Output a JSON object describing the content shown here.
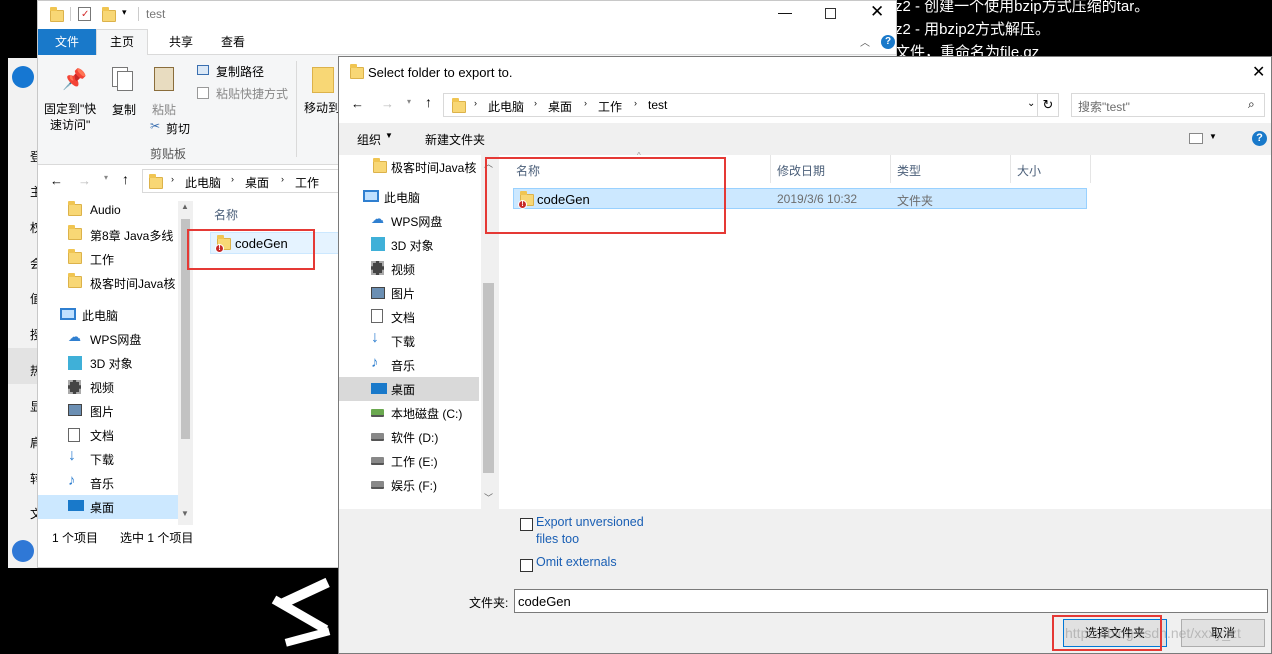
{
  "background": {
    "line1": "z2 - 创建一个使用bzip方式压缩的tar。",
    "line2": "z2 - 用bzip2方式解压。",
    "line3": "文件，重命名为file.gz",
    "left_chars": [
      "登",
      "主",
      "权",
      "会",
      "值",
      "授",
      "热",
      "显",
      "肩",
      "转",
      "文"
    ]
  },
  "explorer": {
    "title": "test",
    "tabs": [
      "文件",
      "主页",
      "共享",
      "查看"
    ],
    "ribbon": {
      "pin": "固定到\"快\n速访问\"",
      "copy": "复制",
      "paste": "粘贴",
      "copy_path": "复制路径",
      "paste_shortcut": "粘贴快捷方式",
      "cut": "剪切",
      "clipboard": "剪贴板",
      "move_to": "移动到"
    },
    "breadcrumb": [
      "此电脑",
      "桌面",
      "工作"
    ],
    "nav_items": [
      "Audio",
      "第8章 Java多线",
      "工作",
      "极客时间Java核",
      "此电脑",
      "WPS网盘",
      "3D 对象",
      "视频",
      "图片",
      "文档",
      "下载",
      "音乐",
      "桌面"
    ],
    "column_name": "名称",
    "file_name": "codeGen",
    "status_count": "1 个项目",
    "status_selected": "选中 1 个项目"
  },
  "dialog": {
    "title": "Select folder to export to.",
    "breadcrumb": [
      "此电脑",
      "桌面",
      "工作",
      "test"
    ],
    "search_placeholder": "搜索\"test\"",
    "organize": "组织",
    "new_folder": "新建文件夹",
    "nav_items": [
      "极客时间Java核",
      "此电脑",
      "WPS网盘",
      "3D 对象",
      "视频",
      "图片",
      "文档",
      "下载",
      "音乐",
      "桌面",
      "本地磁盘 (C:)",
      "软件 (D:)",
      "工作 (E:)",
      "娱乐 (F:)"
    ],
    "columns": [
      "名称",
      "修改日期",
      "类型",
      "大小"
    ],
    "rows": [
      {
        "name": "codeGen",
        "date": "2019/3/6 10:32",
        "type": "文件夹",
        "size": ""
      }
    ],
    "export_unversioned": "Export unversioned\nfiles too",
    "omit_externals": "Omit externals",
    "folder_label": "文件夹:",
    "folder_value": "codeGen",
    "select_button": "选择文件夹",
    "cancel_button": "取消",
    "watermark": "https://blog.csdn.net/xxxy_zt"
  }
}
